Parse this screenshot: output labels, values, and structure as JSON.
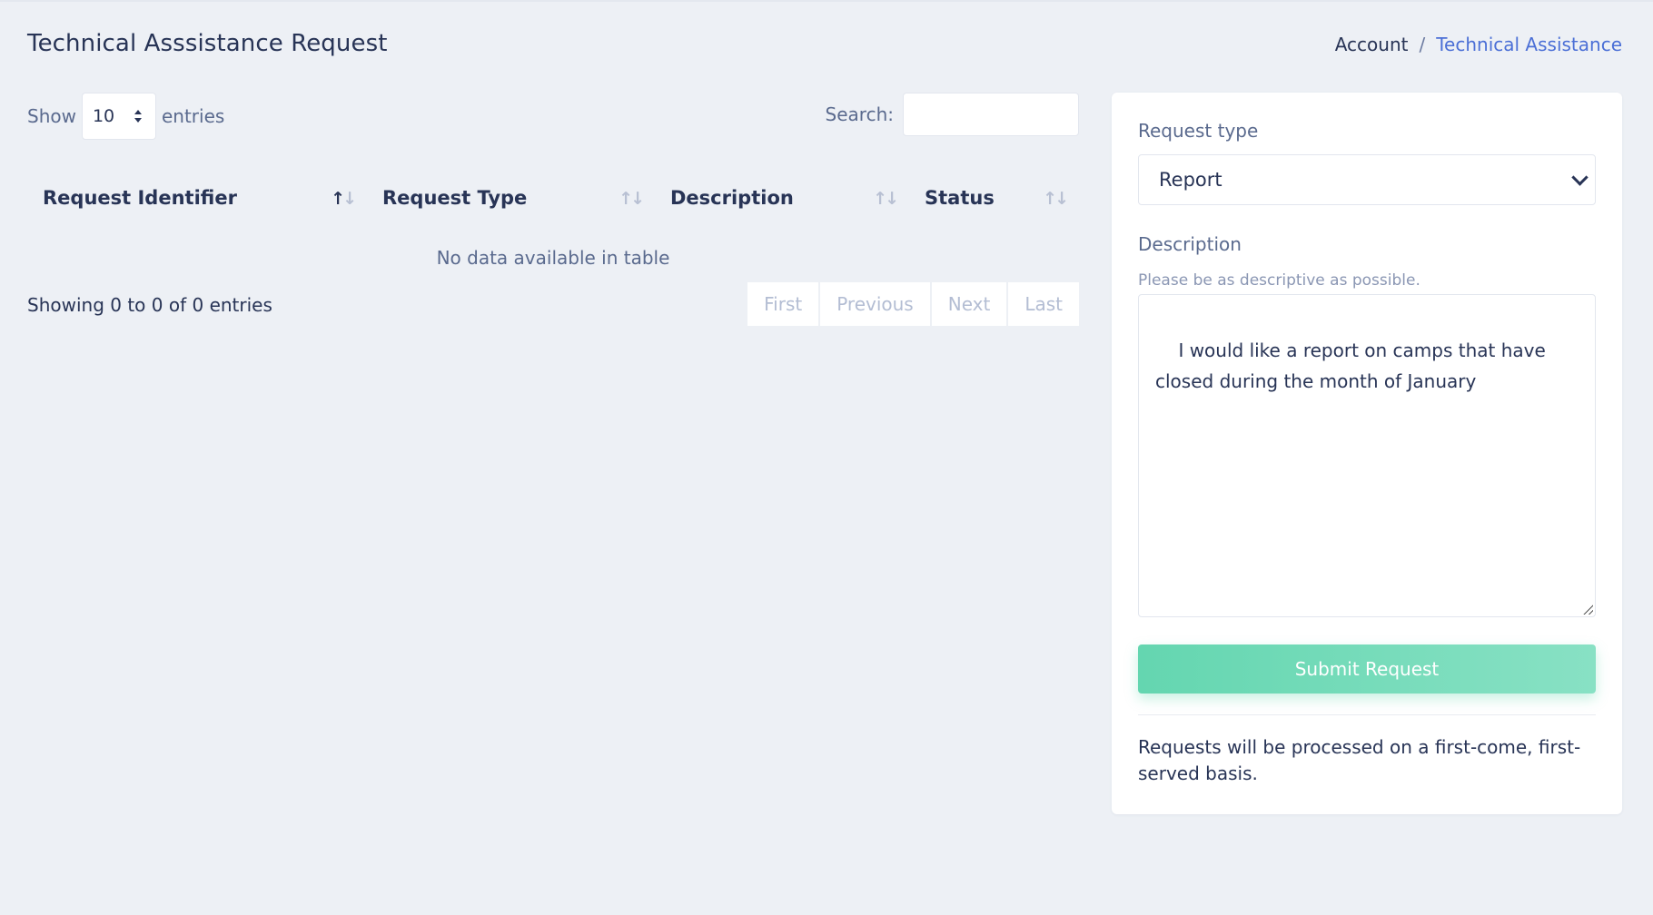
{
  "page": {
    "title": "Technical Asssistance Request"
  },
  "breadcrumb": {
    "parent": "Account",
    "separator": "/",
    "current": "Technical Assistance"
  },
  "table_controls": {
    "show_label": "Show",
    "entries_value": "10",
    "entries_label": "entries",
    "search_label": "Search:",
    "search_value": ""
  },
  "table": {
    "columns": [
      {
        "label": "Request Identifier",
        "sort_icon": "sort-asc-icon"
      },
      {
        "label": "Request Type",
        "sort_icon": "sort-both-icon"
      },
      {
        "label": "Description",
        "sort_icon": "sort-both-icon"
      },
      {
        "label": "Status",
        "sort_icon": "sort-both-icon"
      }
    ],
    "empty_message": "No data available in table",
    "info": "Showing 0 to 0 of 0 entries",
    "pagination": {
      "first": "First",
      "previous": "Previous",
      "next": "Next",
      "last": "Last"
    }
  },
  "form": {
    "request_type_label": "Request type",
    "request_type_value": "Report",
    "description_label": "Description",
    "description_help": "Please be as descriptive as possible.",
    "description_value": "I would like a report on camps that have closed during the month of January",
    "submit_label": "Submit Request",
    "note": "Requests will be processed on a first-come, first-served basis."
  },
  "colors": {
    "background": "#edf0f5",
    "text": "#283456",
    "link": "#4b6fd6",
    "submit": "#64d6b0",
    "muted": "#5a6a8e"
  }
}
